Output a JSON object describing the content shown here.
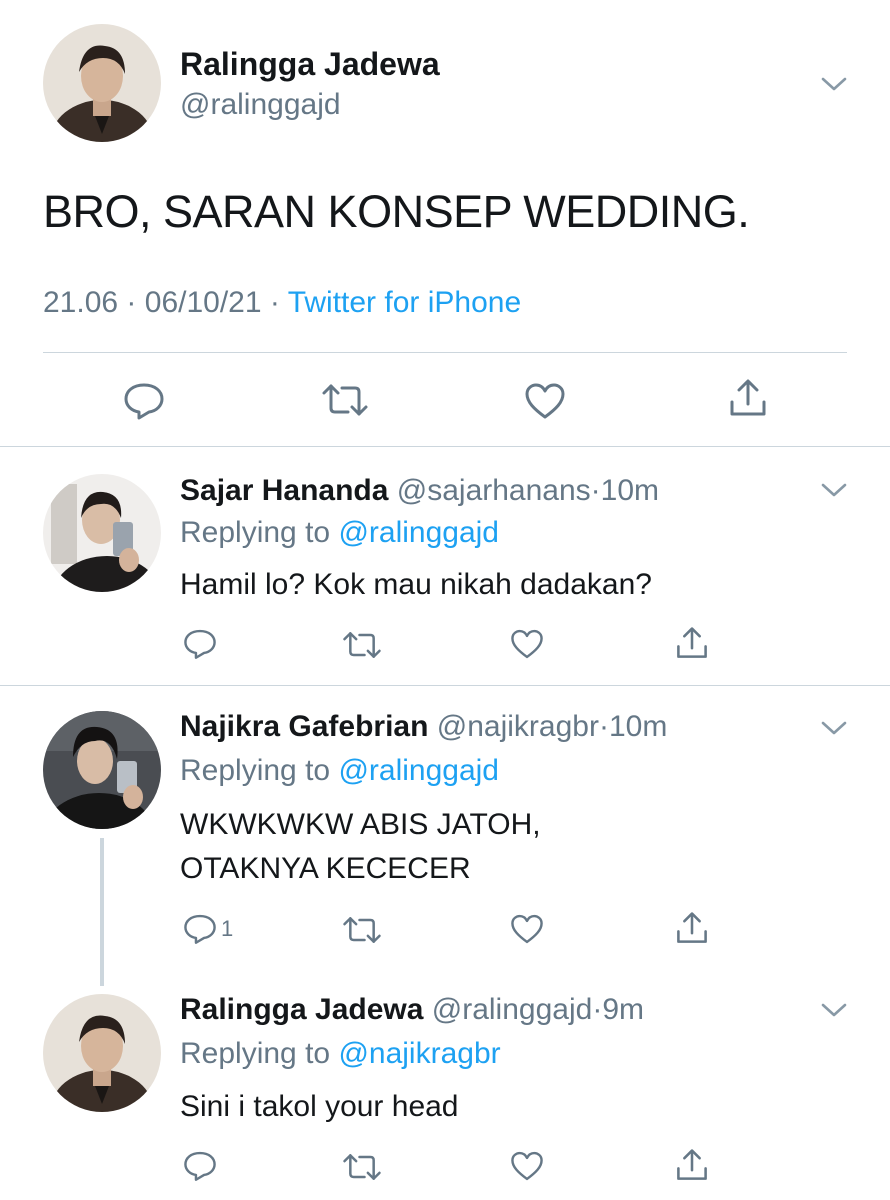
{
  "main_tweet": {
    "author_name": "Ralingga Jadewa",
    "author_handle": "@ralinggajd",
    "text": "BRO, SARAN KONSEP WEDDING.",
    "time": "21.06",
    "date": "06/10/21",
    "separator": "·",
    "source": "Twitter for iPhone"
  },
  "replies": [
    {
      "author_name": "Sajar Hananda",
      "author_handle": "@sajarhanans",
      "age": "10m",
      "replying_prefix": "Replying to",
      "replying_to": "@ralinggajd",
      "text_lines": [
        "Hamil lo? Kok mau nikah dadakan?"
      ],
      "reply_count": ""
    },
    {
      "author_name": "Najikra Gafebrian",
      "author_handle": "@najikragbr",
      "age": "10m",
      "replying_prefix": "Replying to",
      "replying_to": "@ralinggajd",
      "text_lines": [
        "WKWKWKW ABIS JATOH,",
        "OTAKNYA KECECER"
      ],
      "reply_count": "1"
    },
    {
      "author_name": "Ralingga Jadewa",
      "author_handle": "@ralinggajd",
      "age": "9m",
      "replying_prefix": "Replying to",
      "replying_to": "@najikragbr",
      "text_lines": [
        "Sini i takol your head"
      ],
      "reply_count": ""
    }
  ],
  "icons": {
    "reply": "reply-icon",
    "retweet": "retweet-icon",
    "like": "heart-icon",
    "share": "share-icon",
    "more": "chevron-down-icon"
  },
  "colors": {
    "text": "#14171a",
    "secondary": "#657786",
    "link": "#1da1f2",
    "divider": "#ccd6dd"
  }
}
